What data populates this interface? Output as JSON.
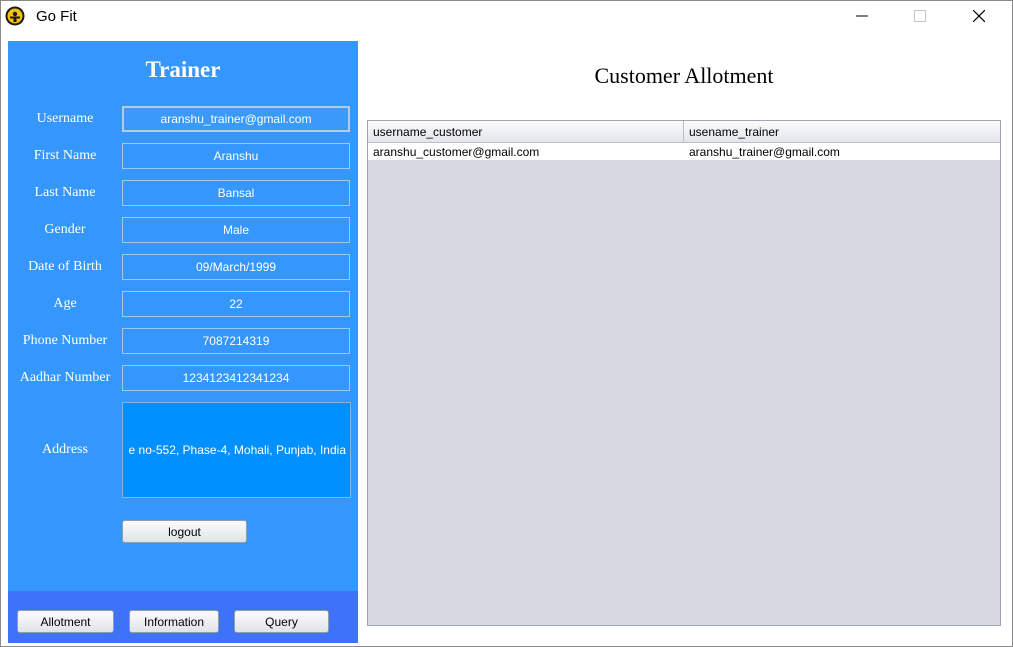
{
  "window": {
    "title": "Go Fit",
    "icon": "gold-gym-logo-icon",
    "controls": [
      "minimize-icon",
      "maximize-icon",
      "close-icon"
    ]
  },
  "profile": {
    "heading": "Trainer",
    "fields": [
      {
        "label": "Username",
        "value": "aranshu_trainer@gmail.com"
      },
      {
        "label": "First Name",
        "value": "Aranshu"
      },
      {
        "label": "Last Name",
        "value": "Bansal"
      },
      {
        "label": "Gender",
        "value": "Male"
      },
      {
        "label": "Date of Birth",
        "value": "09/March/1999"
      },
      {
        "label": "Age",
        "value": "22"
      },
      {
        "label": "Phone Number",
        "value": "7087214319"
      },
      {
        "label": "Aadhar Number",
        "value": "1234123412341234"
      }
    ],
    "address": {
      "label": "Address",
      "value": "e no-552, Phase-4, Mohali, Punjab, India"
    },
    "logout_label": "logout"
  },
  "footer": {
    "buttons": [
      "Allotment",
      "Information",
      "Query"
    ]
  },
  "allotment": {
    "title": "Customer Allotment",
    "columns": [
      "username_customer",
      "usename_trainer"
    ],
    "rows": [
      [
        "aranshu_customer@gmail.com",
        "aranshu_trainer@gmail.com"
      ]
    ]
  },
  "colors": {
    "panel": "#3597fb",
    "footer": "#3d72f9",
    "address_bg": "#0090ff",
    "table_bg": "#d7dae0"
  }
}
